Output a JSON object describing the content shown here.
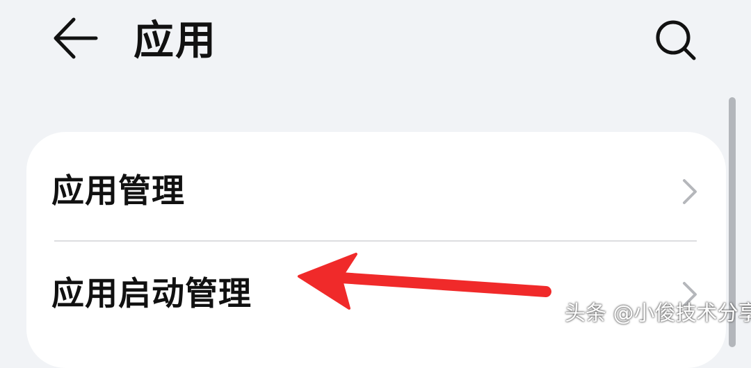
{
  "header": {
    "title": "应用",
    "back_icon": "back-arrow-icon",
    "search_icon": "search-icon"
  },
  "list": {
    "items": [
      {
        "label": "应用管理",
        "icon": "chevron-right-icon"
      },
      {
        "label": "应用启动管理",
        "icon": "chevron-right-icon"
      }
    ]
  },
  "annotation": {
    "arrow_color": "#f02a2a",
    "watermark": "头条 @小俊技术分享"
  },
  "colors": {
    "background": "#f1f3f6",
    "card": "#ffffff",
    "text": "#111111",
    "chevron": "#b5b7bb"
  }
}
